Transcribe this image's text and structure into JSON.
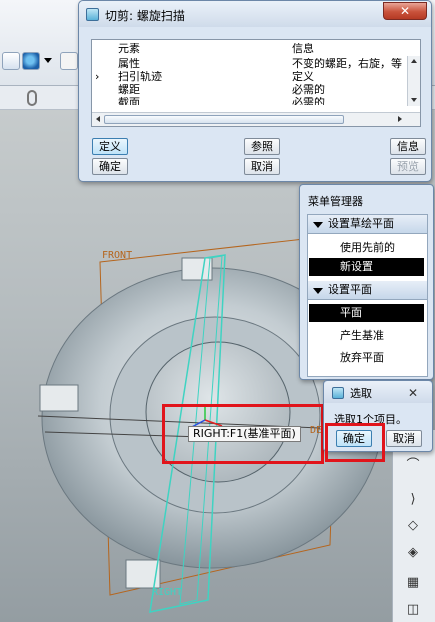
{
  "sweep_dialog": {
    "title": "切剪: 螺旋扫描",
    "columns": [
      "元素",
      "信息"
    ],
    "rows": [
      {
        "marker": "",
        "element": "属性",
        "info": "不变的螺距，右旋，等"
      },
      {
        "marker": "›",
        "element": "扫引轨迹",
        "info": "定义"
      },
      {
        "marker": "",
        "element": "螺距",
        "info": "必需的"
      },
      {
        "marker": "",
        "element": "截面",
        "info": "必需的"
      }
    ],
    "buttons": {
      "define": "定义",
      "reference": "参照",
      "info": "信息",
      "ok": "确定",
      "cancel": "取消",
      "preview": "预览"
    }
  },
  "menu_manager": {
    "title": "菜单管理器",
    "section1": {
      "header": "设置草绘平面",
      "items": [
        {
          "label": "使用先前的",
          "selected": false
        },
        {
          "label": "新设置",
          "selected": true
        }
      ]
    },
    "section2": {
      "header": "设置平面",
      "items": [
        {
          "label": "平面",
          "selected": true
        },
        {
          "label": "产生基准",
          "selected": false
        },
        {
          "label": "放弃平面",
          "selected": false
        }
      ]
    }
  },
  "select_dialog": {
    "title": "选取",
    "prompt": "选取1个项目。",
    "ok": "确定",
    "cancel": "取消"
  },
  "viewport": {
    "tooltip": "RIGHT:F1(基准平面)",
    "datum_front": "FRONT",
    "datum_right": "RIGHT",
    "datum_top_partial": "DE"
  },
  "colors": {
    "highlight_red": "#e1141b",
    "datum_orange": "#b5651d",
    "datum_cyan": "#3fd3c2",
    "selection_black": "#000000"
  }
}
